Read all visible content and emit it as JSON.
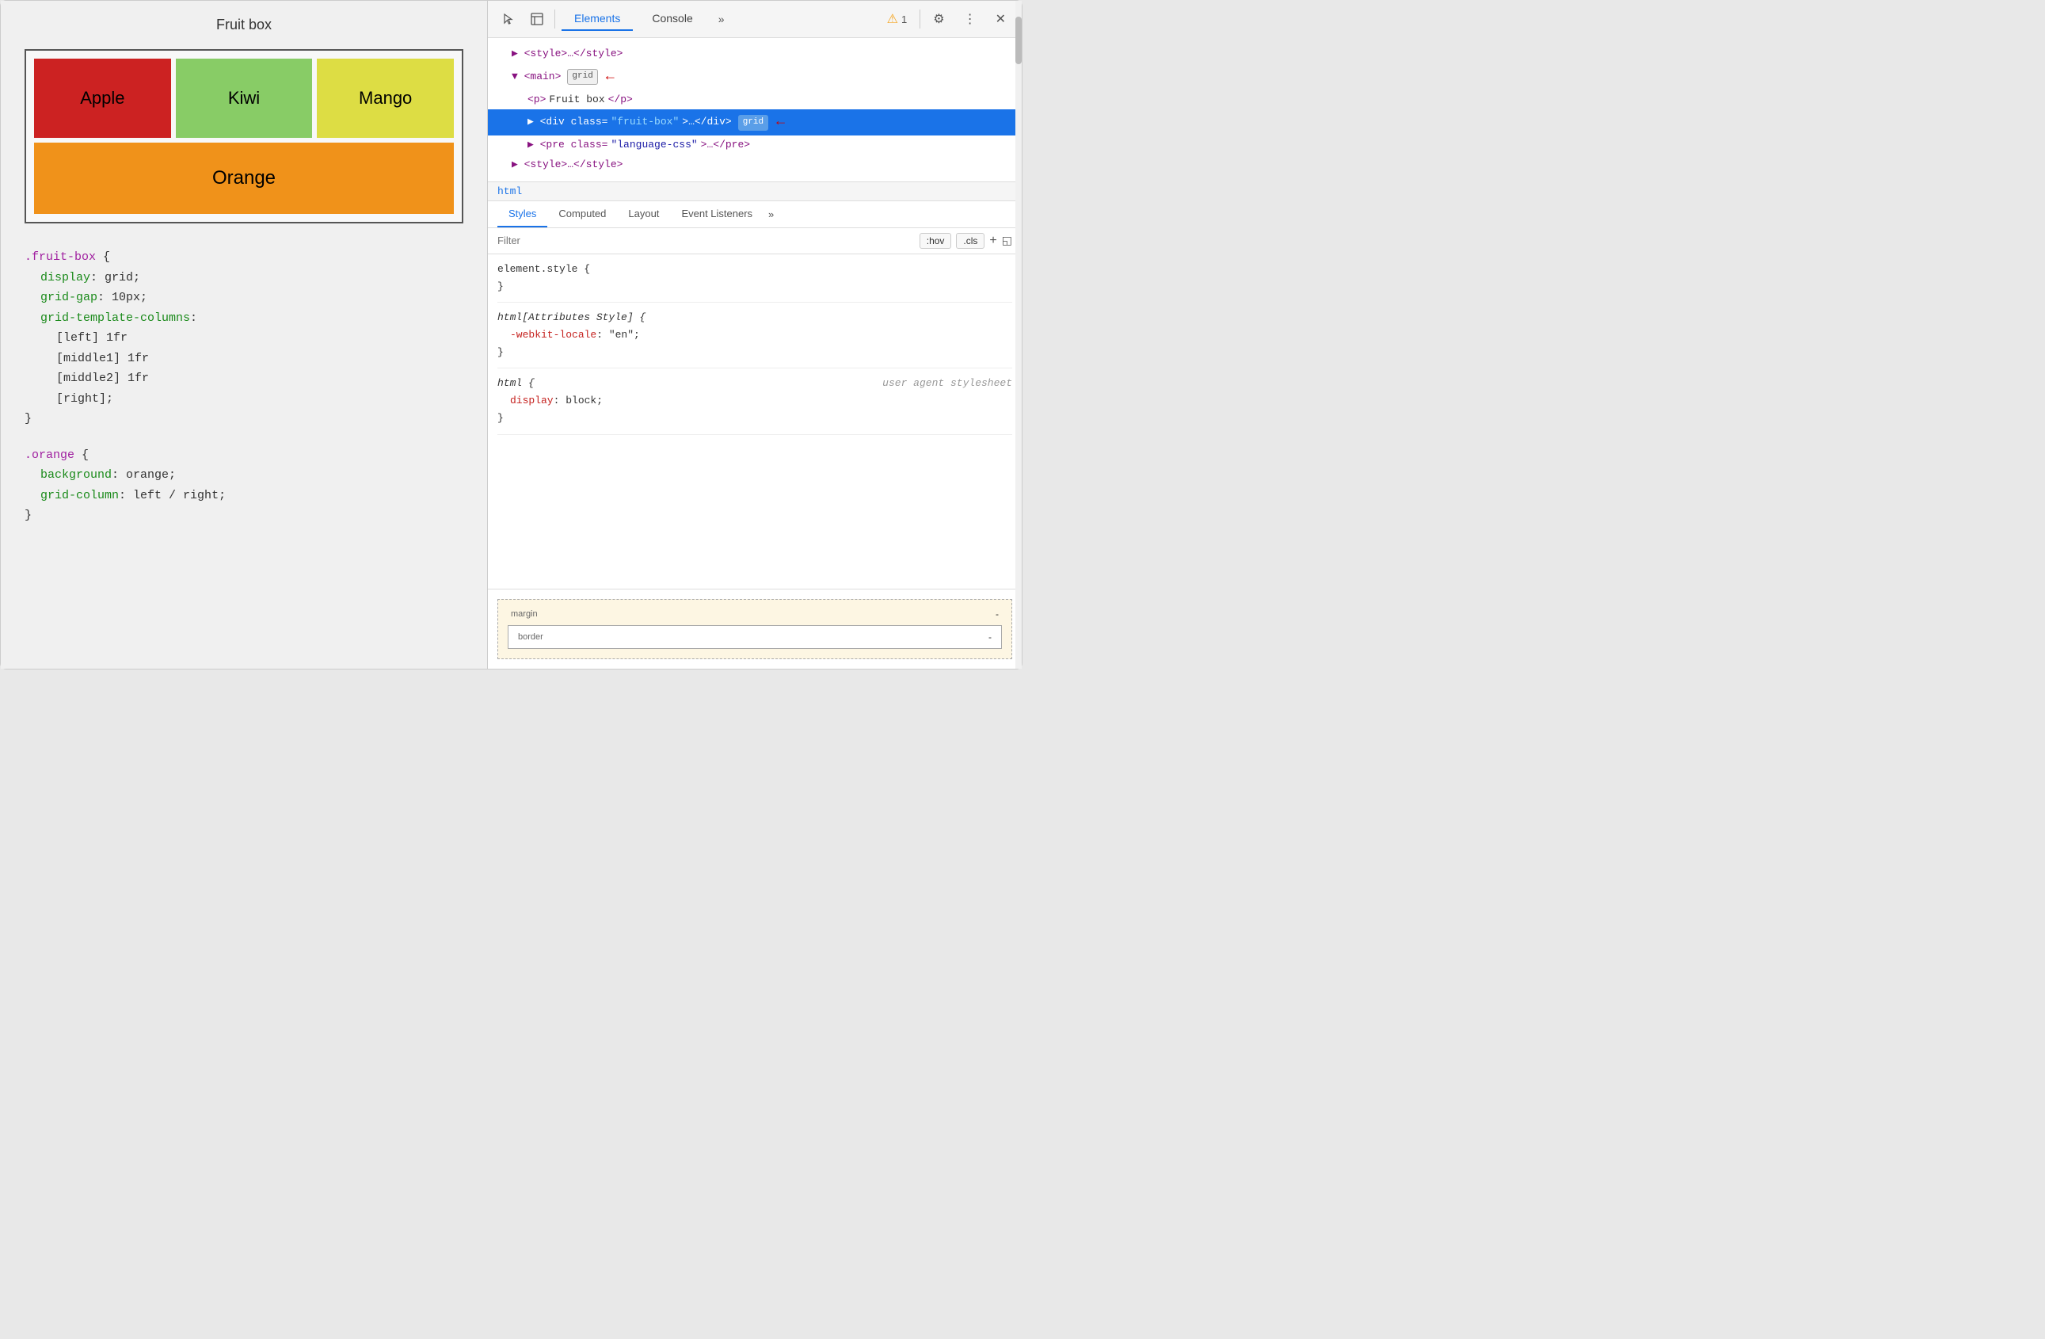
{
  "left": {
    "title": "Fruit box",
    "fruits": [
      {
        "name": "Apple",
        "class": "fruit-apple"
      },
      {
        "name": "Kiwi",
        "class": "fruit-kiwi"
      },
      {
        "name": "Mango",
        "class": "fruit-mango"
      },
      {
        "name": "Orange",
        "class": "fruit-orange"
      }
    ],
    "code_sections": [
      {
        "selector": ".fruit-box",
        "properties": [
          {
            "prop": "display",
            "val": "grid;"
          },
          {
            "prop": "grid-gap",
            "val": "10px;"
          },
          {
            "prop": "grid-template-columns",
            "val": ""
          },
          {
            "prop": "",
            "val": "[left] 1fr"
          },
          {
            "prop": "",
            "val": "[middle1] 1fr"
          },
          {
            "prop": "",
            "val": "[middle2] 1fr"
          },
          {
            "prop": "",
            "val": "[right];"
          }
        ]
      },
      {
        "selector": ".orange",
        "properties": [
          {
            "prop": "background",
            "val": "orange;"
          },
          {
            "prop": "grid-column",
            "val": "left / right;"
          }
        ]
      }
    ]
  },
  "devtools": {
    "tabs": [
      "Elements",
      "Console",
      ">>"
    ],
    "active_tab": "Elements",
    "warning_count": "1",
    "elements_tree": [
      {
        "indent": 1,
        "content": "▶ <style>…</style>",
        "selected": false,
        "badge": null,
        "arrow": false
      },
      {
        "indent": 1,
        "content": "▼ <main>",
        "selected": false,
        "badge": "grid",
        "arrow": true
      },
      {
        "indent": 2,
        "content": "<p>Fruit box</p>",
        "selected": false,
        "badge": null,
        "arrow": false
      },
      {
        "indent": 2,
        "content": "▶ <div class=\"fruit-box\">…</div>",
        "selected": true,
        "badge": "grid",
        "arrow": true
      },
      {
        "indent": 2,
        "content": "▶ <pre class=\"language-css\">…</pre>",
        "selected": false,
        "badge": null,
        "arrow": false
      },
      {
        "indent": 1,
        "content": "▶ <style>…</style>",
        "selected": false,
        "badge": null,
        "arrow": false
      }
    ],
    "breadcrumb": "html",
    "styles_tabs": [
      "Styles",
      "Computed",
      "Layout",
      "Event Listeners",
      ">>"
    ],
    "active_styles_tab": "Styles",
    "filter_placeholder": "Filter",
    "filter_buttons": [
      ":hov",
      ".cls"
    ],
    "css_rules": [
      {
        "selector": "element.style {",
        "close": "}",
        "properties": []
      },
      {
        "selector": "html[Attributes Style] {",
        "close": "}",
        "properties": [
          {
            "prop": "-webkit-locale",
            "val": "\"en\";"
          }
        ],
        "italic": true
      },
      {
        "selector": "html {",
        "close": "}",
        "comment": "user agent stylesheet",
        "properties": [
          {
            "prop": "display",
            "val": "block;"
          }
        ],
        "italic": true
      }
    ],
    "box_model": {
      "margin_label": "margin",
      "margin_val": "-",
      "border_label": "border",
      "border_val": "-"
    }
  }
}
